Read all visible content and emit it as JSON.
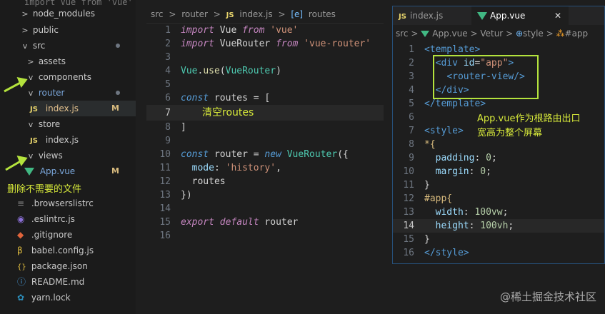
{
  "explorer": {
    "items": [
      {
        "label": "import Vue from 'vue'",
        "kind": "faded"
      },
      {
        "label": "node_modules",
        "kind": "folder",
        "chev": ">"
      },
      {
        "label": "public",
        "kind": "folder",
        "chev": ">"
      },
      {
        "label": "src",
        "kind": "folder",
        "chev": "v"
      },
      {
        "label": "assets",
        "kind": "folder",
        "chev": ">"
      },
      {
        "label": "components",
        "kind": "folder",
        "chev": "v"
      },
      {
        "label": "router",
        "kind": "folder",
        "chev": "v"
      },
      {
        "label": "index.js",
        "kind": "js",
        "badge": "M"
      },
      {
        "label": "store",
        "kind": "folder",
        "chev": "v"
      },
      {
        "label": "index.js",
        "kind": "js"
      },
      {
        "label": "views",
        "kind": "folder",
        "chev": "v"
      },
      {
        "label": "App.vue",
        "kind": "vue",
        "badge": "M"
      },
      {
        "label": ".browserslistrc",
        "kind": "file"
      },
      {
        "label": ".eslintrc.js",
        "kind": "file"
      },
      {
        "label": ".gitignore",
        "kind": "file"
      },
      {
        "label": "babel.config.js",
        "kind": "file"
      },
      {
        "label": "package.json",
        "kind": "json"
      },
      {
        "label": "README.md",
        "kind": "file"
      },
      {
        "label": "yarn.lock",
        "kind": "file"
      }
    ],
    "annotation": "删除不需要的文件"
  },
  "router_editor": {
    "breadcrumb": [
      "src",
      ">",
      "router",
      ">",
      "JS",
      "index.js",
      ">",
      "[e]",
      "routes"
    ],
    "line_numbers": [
      "1",
      "2",
      "3",
      "4",
      "5",
      "6",
      "7",
      "8",
      "9",
      "10",
      "11",
      "12",
      "13",
      "14",
      "15",
      "16"
    ],
    "code": {
      "l1": [
        "import",
        " Vue ",
        "from",
        " 'vue'"
      ],
      "l2": [
        "import",
        " VueRouter ",
        "from",
        " 'vue-router'"
      ],
      "l4": [
        "Vue",
        ".",
        "use",
        "(",
        "VueRouter",
        ")"
      ],
      "l6": [
        "const",
        " routes ",
        "= ["
      ],
      "l7": "清空routes",
      "l8": "]",
      "l10": [
        "const",
        " router ",
        "= ",
        "new",
        " ",
        "VueRouter",
        "({"
      ],
      "l11": [
        "mode",
        ": ",
        "'history'",
        ","
      ],
      "l12": "routes",
      "l13": "})",
      "l15": [
        "export",
        " ",
        "default",
        " router"
      ]
    }
  },
  "app_editor": {
    "tabs": [
      {
        "label": "index.js",
        "icon": "JS"
      },
      {
        "label": "App.vue",
        "icon": "vue"
      }
    ],
    "close_glyph": "✕",
    "breadcrumb": [
      "src",
      ">",
      "App.vue",
      ">",
      "Vetur",
      ">",
      "style",
      ">",
      "#app"
    ],
    "line_numbers": [
      "1",
      "2",
      "3",
      "4",
      "5",
      "6",
      "7",
      "8",
      "9",
      "10",
      "11",
      "12",
      "13",
      "14",
      "15",
      "16"
    ],
    "code": {
      "l1": "<template>",
      "l2a": "<div",
      "l2b": " id",
      "l2c": "=",
      "l2d": "\"app\"",
      "l2e": ">",
      "l3": "<router-view/>",
      "l4": "</div>",
      "l5": "</template>",
      "l7": "<style>",
      "l8": "*{",
      "l9a": "padding",
      "l9b": ": ",
      "l9c": "0",
      "l9d": ";",
      "l10a": "margin",
      "l10b": ": ",
      "l10c": "0",
      "l10d": ";",
      "l11": "}",
      "l12": "#app{",
      "l13a": "width",
      "l13b": ": ",
      "l13c": "100vw",
      "l13d": ";",
      "l14a": "height",
      "l14b": ": ",
      "l14c": "100vh",
      "l14d": ";",
      "l15": "}",
      "l16": "</style>"
    },
    "annotation_1": "App.vue作为根路由出口",
    "annotation_2": "宽高为整个屏幕"
  },
  "watermark": "@稀土掘金技术社区"
}
